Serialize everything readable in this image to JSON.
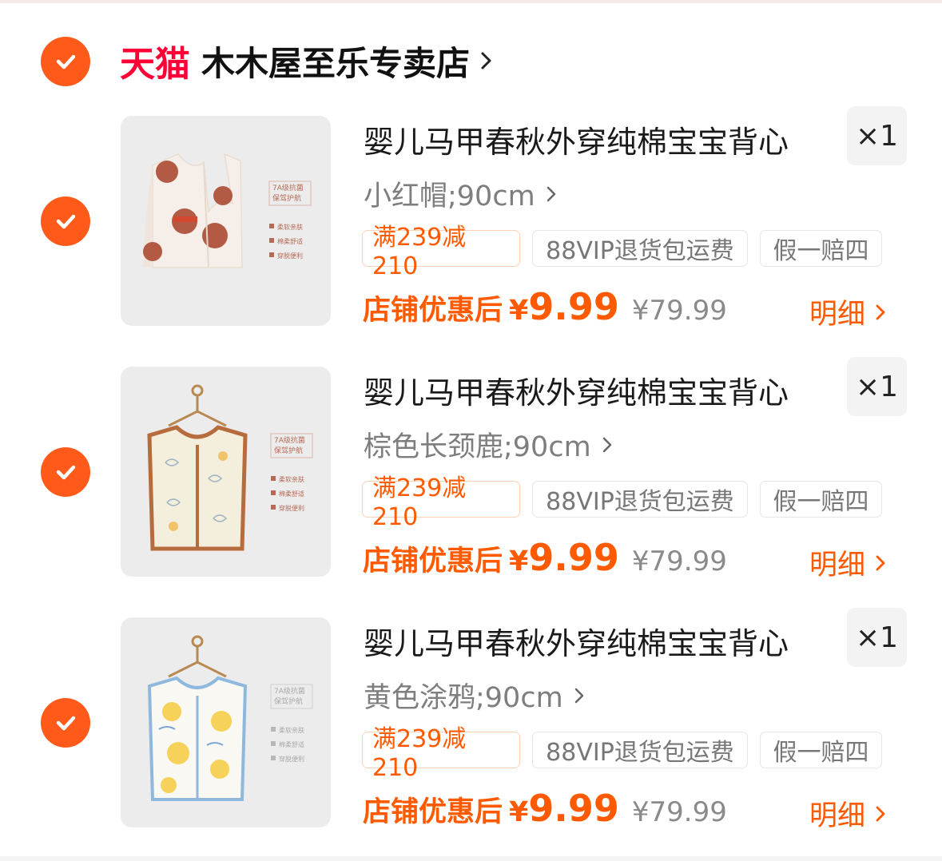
{
  "shop": {
    "logo": "天猫",
    "name": "木木屋至乐专卖店"
  },
  "colors": {
    "accent": "#ff5a00",
    "check": "#ff5a1a",
    "tmall_red": "#ff0036"
  },
  "icons": {
    "check": "check-icon",
    "chevron": "chevron-right-icon"
  },
  "items": [
    {
      "title": "婴儿马甲春秋外穿纯棉宝宝背心",
      "quantity": "×1",
      "sku": "小红帽;90cm",
      "tags": [
        "满239减210",
        "88VIP退货包运费",
        "假一赔四"
      ],
      "price_label": "店铺优惠后",
      "price_currency": "¥",
      "price": "9.99",
      "original_price": "¥79.99",
      "detail_label": "明细",
      "image_text": [
        "7A级抗菌",
        "保驾护航",
        "柔软亲肤",
        "棉柔舒适",
        "穿脱便利"
      ]
    },
    {
      "title": "婴儿马甲春秋外穿纯棉宝宝背心",
      "quantity": "×1",
      "sku": "棕色长颈鹿;90cm",
      "tags": [
        "满239减210",
        "88VIP退货包运费",
        "假一赔四"
      ],
      "price_label": "店铺优惠后",
      "price_currency": "¥",
      "price": "9.99",
      "original_price": "¥79.99",
      "detail_label": "明细",
      "image_text": [
        "7A级抗菌",
        "保驾护航",
        "柔软亲肤",
        "棉柔舒适",
        "穿脱便利"
      ]
    },
    {
      "title": "婴儿马甲春秋外穿纯棉宝宝背心",
      "quantity": "×1",
      "sku": "黄色涂鸦;90cm",
      "tags": [
        "满239减210",
        "88VIP退货包运费",
        "假一赔四"
      ],
      "price_label": "店铺优惠后",
      "price_currency": "¥",
      "price": "9.99",
      "original_price": "¥79.99",
      "detail_label": "明细",
      "image_text": [
        "7A级抗菌",
        "保驾护航",
        "柔软亲肤",
        "棉柔舒适",
        "穿脱便利"
      ]
    }
  ]
}
